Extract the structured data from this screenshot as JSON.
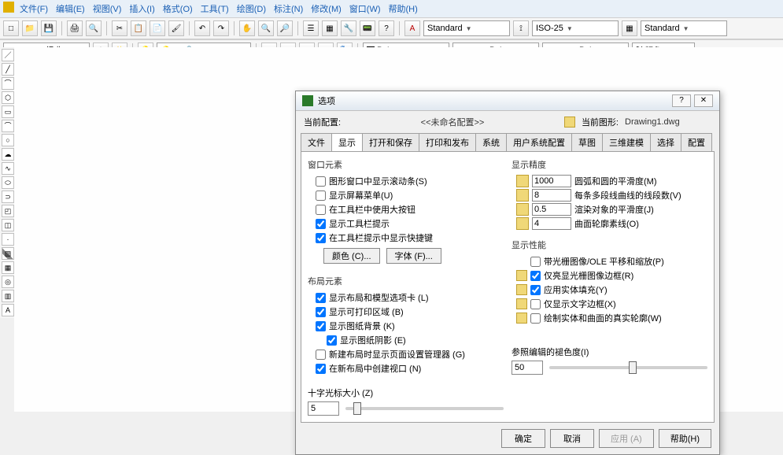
{
  "menu": [
    "文件(F)",
    "编辑(E)",
    "视图(V)",
    "插入(I)",
    "格式(O)",
    "工具(T)",
    "绘图(D)",
    "标注(N)",
    "修改(M)",
    "窗口(W)",
    "帮助(H)"
  ],
  "top_combos": {
    "workspace": "AutoCAD 经典",
    "style_a": "Standard",
    "dim_style": "ISO-25",
    "style_b": "Standard"
  },
  "layer_row": {
    "layer": "ByLayer",
    "color": "ByLayer",
    "linetype": "ByLayer",
    "color_filter": "随颜色"
  },
  "dialog": {
    "title": "选项",
    "cur_config_label": "当前配置:",
    "cur_config_value": "<<未命名配置>>",
    "cur_drawing_label": "当前图形:",
    "cur_drawing_value": "Drawing1.dwg",
    "tabs": [
      "文件",
      "显示",
      "打开和保存",
      "打印和发布",
      "系统",
      "用户系统配置",
      "草图",
      "三维建模",
      "选择",
      "配置"
    ],
    "active_tab": "显示",
    "window_group": {
      "title": "窗口元素",
      "items": [
        {
          "label": "图形窗口中显示滚动条(S)",
          "checked": false
        },
        {
          "label": "显示屏幕菜单(U)",
          "checked": false
        },
        {
          "label": "在工具栏中使用大按钮",
          "checked": false
        },
        {
          "label": "显示工具栏提示",
          "checked": true
        },
        {
          "label": "在工具栏提示中显示快捷键",
          "checked": true
        }
      ],
      "color_btn": "颜色 (C)...",
      "font_btn": "字体 (F)..."
    },
    "layout_group": {
      "title": "布局元素",
      "items": [
        {
          "label": "显示布局和模型选项卡 (L)",
          "checked": true
        },
        {
          "label": "显示可打印区域 (B)",
          "checked": true
        },
        {
          "label": "显示图纸背景 (K)",
          "checked": true
        },
        {
          "label": "显示图纸阴影 (E)",
          "checked": true
        },
        {
          "label": "新建布局时显示页面设置管理器 (G)",
          "checked": false
        },
        {
          "label": "在新布局中创建视口 (N)",
          "checked": true
        }
      ]
    },
    "precision_group": {
      "title": "显示精度",
      "rows": [
        {
          "value": "1000",
          "label": "圆弧和圆的平滑度(M)"
        },
        {
          "value": "8",
          "label": "每条多段线曲线的线段数(V)"
        },
        {
          "value": "0.5",
          "label": "渲染对象的平滑度(J)"
        },
        {
          "value": "4",
          "label": "曲面轮廓素线(O)"
        }
      ]
    },
    "perf_group": {
      "title": "显示性能",
      "items": [
        {
          "label": "带光栅图像/OLE 平移和缩放(P)",
          "checked": false,
          "icon": false
        },
        {
          "label": "仅亮显光栅图像边框(R)",
          "checked": true,
          "icon": true
        },
        {
          "label": "应用实体填充(Y)",
          "checked": true,
          "icon": true
        },
        {
          "label": "仅显示文字边框(X)",
          "checked": false,
          "icon": true
        },
        {
          "label": "绘制实体和曲面的真实轮廓(W)",
          "checked": false,
          "icon": true
        }
      ]
    },
    "crosshair": {
      "label": "十字光标大小 (Z)",
      "value": "5",
      "thumb_pct": 5
    },
    "refedit": {
      "label": "参照编辑的褪色度(I)",
      "value": "50",
      "thumb_pct": 50
    },
    "buttons": {
      "ok": "确定",
      "cancel": "取消",
      "apply": "应用 (A)",
      "help": "帮助(H)"
    }
  }
}
